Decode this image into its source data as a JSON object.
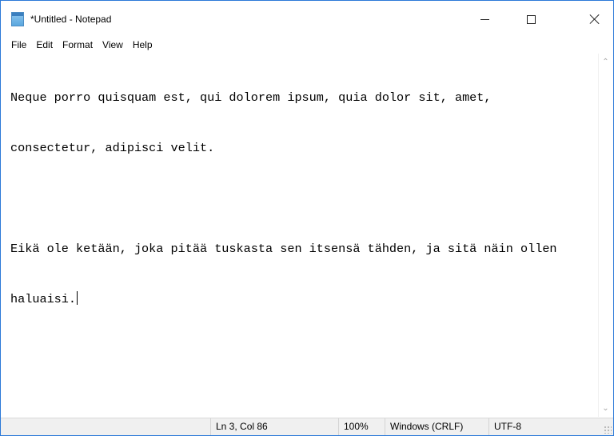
{
  "window": {
    "title": "*Untitled - Notepad",
    "icon": "notepad-icon",
    "controls": [
      "minimize-icon",
      "maximize-icon",
      "close-icon"
    ]
  },
  "menu": {
    "items": [
      "File",
      "Edit",
      "Format",
      "View",
      "Help"
    ]
  },
  "editor": {
    "lines": [
      "Neque porro quisquam est, qui dolorem ipsum, quia dolor sit, amet,",
      "consectetur, adipisci velit.",
      "",
      "Eikä ole ketään, joka pitää tuskasta sen itsensä tähden, ja sitä näin ollen",
      "haluaisi."
    ]
  },
  "status": {
    "position": "Ln 3, Col 86",
    "zoom": "100%",
    "line_ending": "Windows (CRLF)",
    "encoding": "UTF-8"
  },
  "colors": {
    "window_border": "#2b79d8",
    "statusbar_bg": "#f0f0f0"
  }
}
